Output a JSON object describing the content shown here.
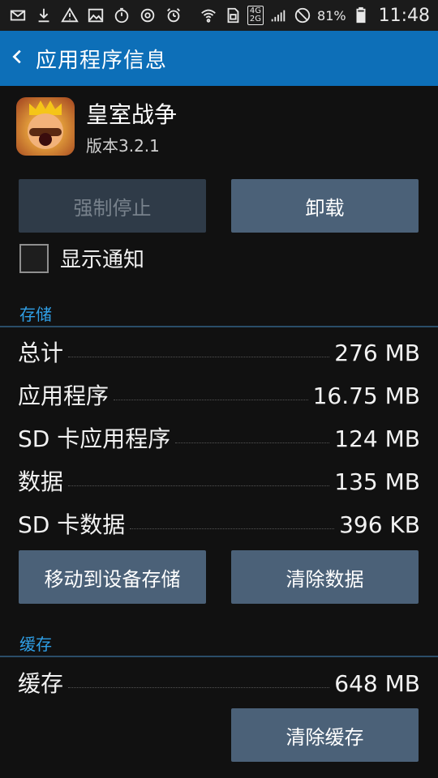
{
  "status_bar": {
    "battery": "81%",
    "time": "11:48",
    "network_badge_top": "4G",
    "network_badge_bottom": "2G",
    "icons": [
      "mail-icon",
      "download-icon",
      "warning-icon",
      "image-icon",
      "timer-icon",
      "sync-icon",
      "alarm-icon",
      "wifi-icon",
      "sim-icon",
      "signal-icon",
      "blocked-icon",
      "battery-icon"
    ]
  },
  "action_bar": {
    "title": "应用程序信息",
    "back_icon": "chevron-left-icon"
  },
  "app": {
    "name": "皇室战争",
    "version": "版本3.2.1",
    "icon": "clash-royale-app-icon"
  },
  "buttons": {
    "force_stop": "强制停止",
    "uninstall": "卸载",
    "move_to_device": "移动到设备存储",
    "clear_data": "清除数据",
    "clear_cache": "清除缓存"
  },
  "notifications": {
    "label": "显示通知",
    "checked": false
  },
  "storage": {
    "title": "存储",
    "rows": [
      {
        "label": "总计",
        "value": "276 MB"
      },
      {
        "label": "应用程序",
        "value": "16.75 MB"
      },
      {
        "label": "SD 卡应用程序",
        "value": "124 MB"
      },
      {
        "label": "数据",
        "value": "135 MB"
      },
      {
        "label": "SD 卡数据",
        "value": "396 KB"
      }
    ]
  },
  "cache": {
    "title": "缓存",
    "label": "缓存",
    "value": "648 MB"
  },
  "colors": {
    "action_bar": "#0d6fb8",
    "section_title": "#2f9fe6",
    "button": "#4b6178",
    "button_disabled": "#2f3b48",
    "background": "#111111"
  }
}
